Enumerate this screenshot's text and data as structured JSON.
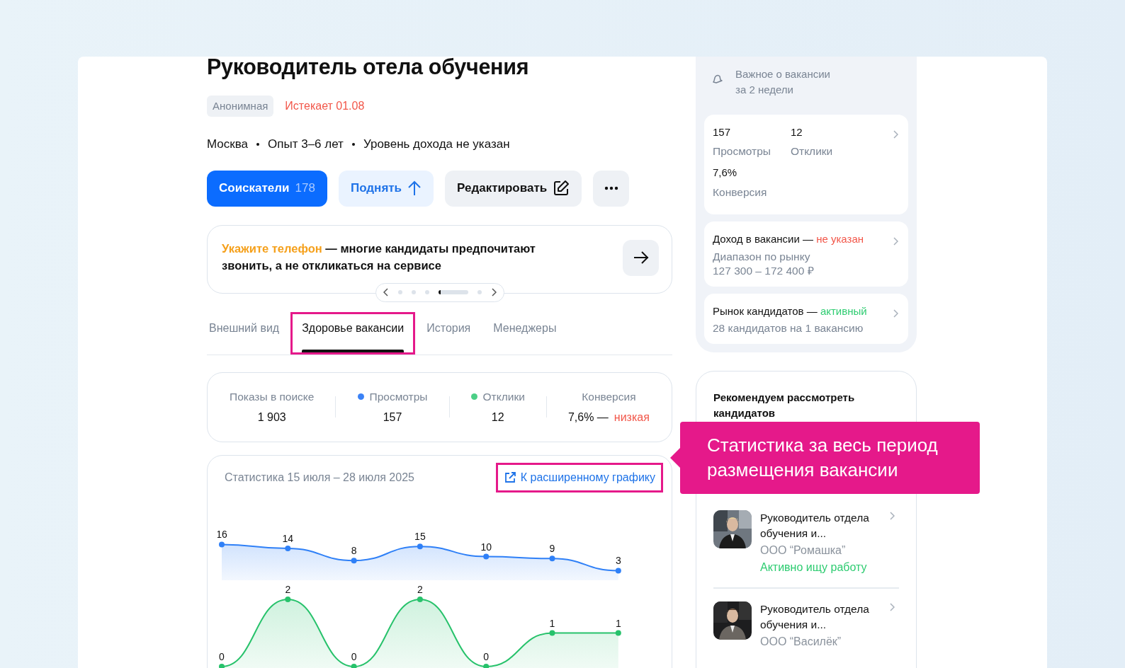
{
  "vacancy": {
    "title": "Руководитель отела обучения",
    "tags": [
      {
        "kind": "badge",
        "text": "Анонимная"
      },
      {
        "kind": "warning",
        "text": "Истекает 01.08"
      }
    ],
    "meta": [
      "Москва",
      "Опыт 3–6 лет",
      "Уровень дохода не указан"
    ],
    "actions": [
      {
        "kind": "primary",
        "label": "Соискатели",
        "count": "178"
      },
      {
        "kind": "raise",
        "label": "Поднять"
      },
      {
        "kind": "edit",
        "label": "Редактировать"
      },
      {
        "kind": "more"
      }
    ]
  },
  "banner": {
    "highlight": "Укажите телефон",
    "text": " — многие кандидаты предпочитают звонить, а не откликаться на сервисе"
  },
  "pager": {
    "level": 0.08,
    "pages": [
      {
        "selected": false
      },
      {
        "selected": false
      },
      {
        "selected": false
      },
      {
        "selected": true
      },
      {
        "selected": false
      }
    ]
  },
  "tabs": [
    {
      "label": "Внешний вид",
      "selected": false,
      "highlighted": false
    },
    {
      "label": "Здоровье вакансии",
      "selected": true,
      "highlighted": true
    },
    {
      "label": "История",
      "selected": false,
      "highlighted": false
    },
    {
      "label": "Менеджеры",
      "selected": false,
      "highlighted": false
    }
  ],
  "stats": [
    {
      "label": "Показы в поиске",
      "value": "1 903"
    },
    {
      "label": "Просмотры",
      "value": "157",
      "color": "#3b82f6"
    },
    {
      "label": "Отклики",
      "value": "12",
      "color": "#4ccf86"
    },
    {
      "label": "Конверсия",
      "value": "7,6% —",
      "rating": "низкая"
    }
  ],
  "chart": {
    "title": "Статистика 15 июля – 28 июля 2025",
    "link": {
      "label": "К расширенному графику",
      "highlighted": true
    },
    "charts": [
      {
        "chart_data": {
          "type": "area",
          "data_labels": true,
          "series": [
            {
              "color": "#2f80f7",
              "values": [
                16,
                14,
                8,
                15,
                10,
                9,
                3
              ]
            }
          ]
        }
      },
      {
        "chart_data": {
          "type": "area",
          "data_labels": true,
          "series": [
            {
              "color": "#27c26b",
              "values": [
                0,
                2,
                0,
                2,
                0,
                1,
                1
              ]
            }
          ]
        }
      }
    ]
  },
  "summary": {
    "title": "Важное о вакансии за 2 недели",
    "cards": [
      {
        "kind": "metrics",
        "metrics": [
          {
            "value": "157",
            "label": "Просмотры"
          },
          {
            "value": "12",
            "label": "Отклики"
          },
          {
            "value": "7,6%",
            "label": "Конверсия"
          }
        ]
      },
      {
        "kind": "status",
        "title": "Доход в вакансии —",
        "status": "не указан",
        "color": "#f2574a",
        "details": [
          "Диапазон по рынку",
          "127 300 – 172 400 ₽"
        ]
      },
      {
        "kind": "status",
        "title": "Рынок кандидатов —",
        "status": "активный",
        "color": "#2ecc71",
        "details": [
          "28 кандидатов на 1 вакансию"
        ]
      }
    ]
  },
  "recommend": {
    "title": "Рекомендуем рассмотреть кандидатов",
    "candidates": [
      {
        "position": "Руководитель отдела обучения и...",
        "company": "ООО “Ромашка”",
        "status": "Активно ищу работу"
      },
      {
        "position": "Руководитель отдела обучения и...",
        "company": "ООО “Василёк”"
      }
    ]
  },
  "callout": {
    "text": "Статистика за весь период размещения вакансии"
  }
}
